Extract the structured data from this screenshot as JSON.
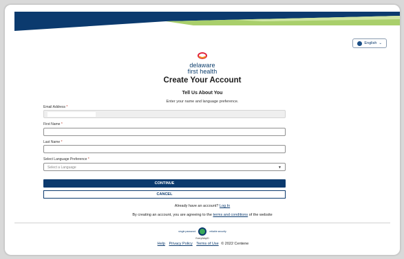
{
  "header": {
    "language_label": "English",
    "language_caret": "⌄"
  },
  "brand": {
    "line1": "delaware",
    "line2": "first health"
  },
  "page": {
    "title": "Create Your Account",
    "subtitle": "Tell Us About You",
    "instruction": "Enter your name and language preference."
  },
  "form": {
    "email_label": "Email Address",
    "first_name_label": "First Name",
    "last_name_label": "Last Name",
    "language_label": "Select Language Preference",
    "language_placeholder": "Select a Language",
    "required_mark": "*"
  },
  "actions": {
    "continue": "CONTINUE",
    "cancel": "CANCEL"
  },
  "footer_text": {
    "already": "Already have an account?",
    "login": "Log In",
    "agree_pre": "By creating an account, you are agreeing to the",
    "terms": "terms and conditions",
    "agree_post": "of the website"
  },
  "badge": {
    "left": "single password",
    "right": "reliable security",
    "sub": "EveryWayID"
  },
  "footer_links": {
    "help": "Help",
    "privacy": "Privacy Policy",
    "terms": "Terms of Use",
    "copyright": "© 2022 Centene"
  },
  "colors": {
    "navy": "#0b3a6e",
    "banner_green": "#a9cf6b",
    "logo_red": "#e0233d",
    "logo_orange": "#f08a24"
  }
}
